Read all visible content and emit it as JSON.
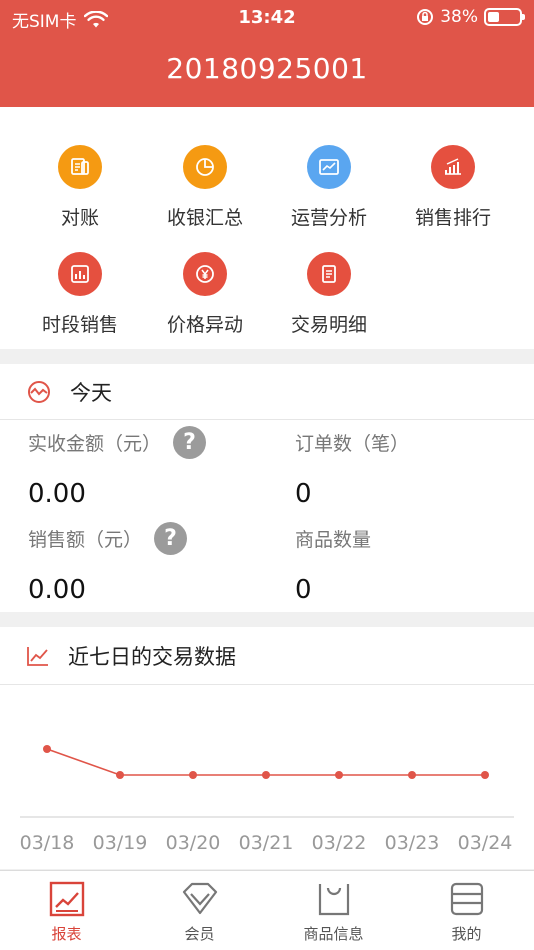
{
  "status_bar": {
    "carrier": "无SIM卡",
    "time": "13:42",
    "battery": "38%",
    "battery_level": 0.38
  },
  "header": {
    "title": "20180925001"
  },
  "colors": {
    "brand": "#e05549",
    "orange": "#f59a12",
    "blue": "#5aa6f0",
    "red": "#e5503f"
  },
  "grid": [
    {
      "label": "对账",
      "icon": "receipt-icon",
      "color": "#f59a12"
    },
    {
      "label": "收银汇总",
      "icon": "pie-chart-icon",
      "color": "#f59a12"
    },
    {
      "label": "运营分析",
      "icon": "line-chart-icon",
      "color": "#5aa6f0"
    },
    {
      "label": "销售排行",
      "icon": "bar-rank-icon",
      "color": "#e5503f"
    },
    {
      "label": "时段销售",
      "icon": "bar-chart-icon",
      "color": "#e5503f"
    },
    {
      "label": "价格异动",
      "icon": "yen-icon",
      "color": "#e5503f"
    },
    {
      "label": "交易明细",
      "icon": "document-icon",
      "color": "#e5503f"
    }
  ],
  "today": {
    "title": "今天",
    "received_amount": {
      "label": "实收金额（元）",
      "value": "0.00"
    },
    "order_count": {
      "label": "订单数（笔）",
      "value": "0"
    },
    "sales_amount": {
      "label": "销售额（元）",
      "value": "0.00"
    },
    "product_count": {
      "label": "商品数量",
      "value": "0"
    }
  },
  "trend": {
    "title": "近七日的交易数据"
  },
  "chart_data": {
    "type": "line",
    "x": [
      "03/18",
      "03/19",
      "03/20",
      "03/21",
      "03/22",
      "03/23",
      "03/24"
    ],
    "series": [
      {
        "values": [
          1,
          0,
          0,
          0,
          0,
          0,
          0
        ]
      }
    ],
    "color": "#e05549"
  },
  "tabs": [
    {
      "label": "报表",
      "icon": "report-icon",
      "active": true
    },
    {
      "label": "会员",
      "icon": "diamond-icon",
      "active": false
    },
    {
      "label": "商品信息",
      "icon": "shopping-bag-icon",
      "active": false
    },
    {
      "label": "我的",
      "icon": "profile-card-icon",
      "active": false
    }
  ]
}
